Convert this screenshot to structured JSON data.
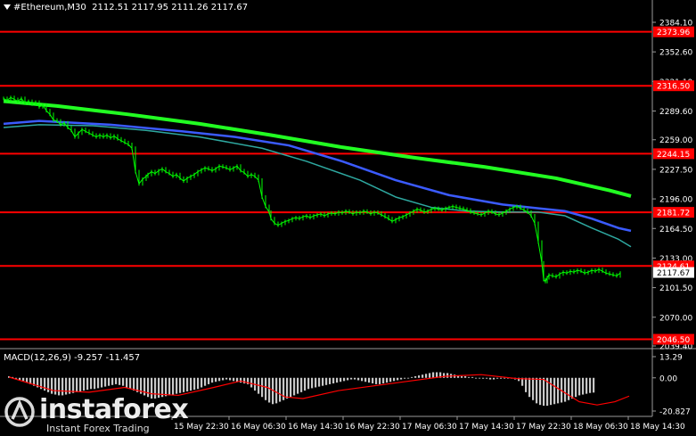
{
  "header": {
    "symbol": "#Ethereum,M30",
    "ohlc": "2112.51 2117.95 2111.26 2117.67"
  },
  "macd": {
    "label": "MACD(12,26,9) -9.257 -11.457",
    "axis": [
      "13.29",
      "0.00",
      "-20.827"
    ]
  },
  "price_axis": [
    "2384.10",
    "2352.60",
    "2321.10",
    "2289.60",
    "2259.00",
    "2227.50",
    "2196.00",
    "2164.50",
    "2133.00",
    "2101.50",
    "2070.00",
    "2039.40"
  ],
  "levels": [
    {
      "label": "2373.96",
      "value": 2373.96
    },
    {
      "label": "2316.50",
      "value": 2316.5
    },
    {
      "label": "2244.15",
      "value": 2244.15
    },
    {
      "label": "2181.72",
      "value": 2181.72
    },
    {
      "label": "2124.61",
      "value": 2124.61
    },
    {
      "label": "2046.50",
      "value": 2046.5
    }
  ],
  "current_price": {
    "label": "2117.67",
    "value": 2117.67
  },
  "time_axis": [
    "15 May 22:30",
    "16 May 06:30",
    "16 May 14:30",
    "16 May 22:30",
    "17 May 06:30",
    "17 May 14:30",
    "17 May 22:30",
    "18 May 06:30",
    "18 May 14:30"
  ],
  "watermark": {
    "brand": "instaforex",
    "tagline": "Instant Forex Trading"
  },
  "colors": {
    "background": "#000000",
    "level": "#ff0000",
    "price": "#00ff00",
    "ma_fast": "#2ea8a0",
    "ma_mid": "#3b5bff",
    "ma_slow": "#22ff22",
    "histogram": "#c8c8c8",
    "signal": "#ff0000"
  },
  "chart_data": {
    "type": "candlestick",
    "price": {
      "x": [
        0,
        4,
        8,
        12,
        16,
        20,
        24,
        28,
        32,
        36,
        40,
        44,
        48,
        52,
        56,
        60,
        64,
        68,
        72,
        76,
        80,
        84,
        88,
        92,
        96,
        100,
        104,
        108,
        112,
        116,
        120,
        124,
        128,
        132,
        136,
        140,
        144,
        148,
        152,
        156,
        160,
        162,
        166,
        170,
        174,
        178,
        182,
        186,
        190,
        194,
        198,
        202,
        206,
        210,
        214,
        218,
        222,
        226,
        230,
        234,
        238,
        242,
        246,
        250,
        254,
        258,
        262,
        266,
        270,
        274,
        278,
        282,
        286,
        290,
        294,
        298,
        300,
        304,
        308,
        312,
        316,
        320,
        324,
        328,
        332,
        336,
        340,
        344,
        348,
        352,
        356,
        360,
        364,
        368,
        372,
        376,
        380,
        384,
        388,
        392,
        396,
        400,
        404,
        408,
        412,
        416,
        420,
        424,
        428,
        432,
        436,
        440,
        444,
        448,
        452,
        456,
        460,
        464,
        468,
        472,
        476,
        480,
        484,
        488,
        492,
        496,
        500,
        504,
        508,
        512,
        516,
        520,
        524,
        528,
        532,
        536,
        540,
        544,
        548,
        552,
        556,
        560,
        564,
        568,
        572,
        576,
        580,
        584,
        588,
        592,
        596,
        600,
        604,
        606,
        608,
        610,
        612,
        616,
        620,
        624,
        628,
        632,
        636,
        640,
        644,
        648,
        652,
        656,
        660,
        664,
        668,
        672,
        676,
        680,
        684,
        688,
        692,
        696,
        700,
        704
      ],
      "y": [
        2303,
        2301,
        2304,
        2302,
        2300,
        2303,
        2298,
        2300,
        2297,
        2299,
        2294,
        2296,
        2290,
        2286,
        2280,
        2279,
        2275,
        2277,
        2272,
        2269,
        2262,
        2266,
        2270,
        2268,
        2266,
        2264,
        2262,
        2264,
        2262,
        2264,
        2261,
        2263,
        2260,
        2258,
        2256,
        2254,
        2250,
        2225,
        2212,
        2217,
        2220,
        2222,
        2225,
        2223,
        2226,
        2228,
        2225,
        2223,
        2220,
        2222,
        2218,
        2215,
        2218,
        2220,
        2222,
        2225,
        2227,
        2229,
        2228,
        2226,
        2228,
        2231,
        2230,
        2229,
        2227,
        2229,
        2231,
        2226,
        2224,
        2220,
        2222,
        2220,
        2216,
        2198,
        2188,
        2182,
        2175,
        2170,
        2168,
        2170,
        2172,
        2173,
        2175,
        2176,
        2175,
        2177,
        2178,
        2176,
        2178,
        2179,
        2180,
        2178,
        2180,
        2181,
        2180,
        2182,
        2181,
        2183,
        2182,
        2180,
        2182,
        2181,
        2183,
        2182,
        2180,
        2182,
        2181,
        2179,
        2177,
        2175,
        2172,
        2174,
        2176,
        2177,
        2179,
        2181,
        2183,
        2185,
        2184,
        2182,
        2183,
        2185,
        2186,
        2185,
        2184,
        2186,
        2187,
        2188,
        2187,
        2186,
        2185,
        2184,
        2182,
        2181,
        2180,
        2179,
        2181,
        2183,
        2182,
        2180,
        2179,
        2181,
        2183,
        2185,
        2187,
        2188,
        2186,
        2184,
        2182,
        2178,
        2170,
        2150,
        2128,
        2110,
        2108,
        2112,
        2115,
        2114,
        2113,
        2116,
        2118,
        2117,
        2119,
        2118,
        2120,
        2119,
        2117,
        2118,
        2120,
        2119,
        2121,
        2119,
        2117,
        2116,
        2115,
        2114,
        2117
      ]
    },
    "ma_slow": {
      "x": [
        0,
        60,
        140,
        220,
        300,
        380,
        460,
        540,
        620,
        680,
        704
      ],
      "y": [
        2300,
        2295,
        2286,
        2276,
        2264,
        2251,
        2240,
        2230,
        2218,
        2205,
        2199
      ]
    },
    "ma_mid": {
      "x": [
        0,
        40,
        120,
        200,
        260,
        320,
        380,
        440,
        500,
        560,
        600,
        630,
        660,
        690,
        704
      ],
      "y": [
        2276,
        2279,
        2275,
        2268,
        2262,
        2253,
        2236,
        2216,
        2200,
        2190,
        2186,
        2183,
        2175,
        2165,
        2162
      ]
    },
    "ma_fast": {
      "x": [
        0,
        40,
        100,
        160,
        220,
        290,
        340,
        400,
        440,
        480,
        520,
        560,
        600,
        630,
        660,
        690,
        704
      ],
      "y": [
        2272,
        2275,
        2274,
        2269,
        2262,
        2250,
        2236,
        2216,
        2198,
        2187,
        2183,
        2182,
        2182,
        2178,
        2165,
        2153,
        2145
      ]
    },
    "macd_hist": {
      "x": [
        10,
        14,
        18,
        22,
        26,
        30,
        34,
        38,
        42,
        46,
        50,
        54,
        58,
        62,
        66,
        70,
        74,
        78,
        82,
        86,
        90,
        94,
        98,
        102,
        106,
        110,
        114,
        118,
        122,
        126,
        130,
        134,
        138,
        142,
        146,
        150,
        154,
        158,
        162,
        166,
        170,
        174,
        178,
        182,
        186,
        190,
        194,
        198,
        202,
        206,
        210,
        214,
        218,
        222,
        226,
        230,
        234,
        238,
        242,
        246,
        250,
        254,
        258,
        262,
        266,
        270,
        274,
        278,
        282,
        286,
        290,
        294,
        298,
        302,
        306,
        310,
        314,
        318,
        322,
        326,
        330,
        334,
        338,
        342,
        346,
        350,
        354,
        358,
        362,
        366,
        370,
        374,
        378,
        382,
        386,
        390,
        394,
        398,
        402,
        406,
        410,
        414,
        418,
        422,
        426,
        430,
        434,
        438,
        442,
        446,
        450,
        454,
        458,
        462,
        466,
        470,
        474,
        478,
        482,
        486,
        490,
        494,
        498,
        502,
        506,
        510,
        514,
        518,
        522,
        526,
        530,
        534,
        538,
        542,
        546,
        550,
        554,
        558,
        562,
        566,
        570,
        574,
        578,
        582,
        586,
        590,
        594,
        598,
        602,
        606,
        610,
        614,
        618,
        622,
        626,
        630,
        634,
        638,
        642,
        646,
        650,
        654,
        658,
        662,
        666,
        670,
        674,
        678,
        682,
        686,
        690,
        694,
        698,
        702,
        706
      ],
      "values": [
        1,
        0.5,
        -0.5,
        -1.5,
        -2,
        -3,
        -4,
        -5,
        -6,
        -7,
        -8,
        -9,
        -10,
        -10.5,
        -11,
        -11,
        -10.5,
        -10,
        -9.5,
        -9,
        -8.5,
        -8,
        -7.5,
        -7,
        -7,
        -6.5,
        -6,
        -5.5,
        -5,
        -4.5,
        -4,
        -4.5,
        -5,
        -6,
        -7,
        -8,
        -9,
        -10,
        -11,
        -12,
        -13,
        -13,
        -12.5,
        -12,
        -11.5,
        -11,
        -10.5,
        -10,
        -9.5,
        -9,
        -8.5,
        -8,
        -7.5,
        -7,
        -6,
        -5,
        -4,
        -3,
        -2.5,
        -2,
        -1.5,
        -1,
        -1.5,
        -2,
        -2.5,
        -3,
        -3.5,
        -4,
        -6,
        -8,
        -10,
        -12,
        -14,
        -15.5,
        -16.5,
        -16,
        -15,
        -14,
        -13,
        -12,
        -11,
        -10,
        -9,
        -8,
        -7,
        -6.5,
        -6,
        -5.5,
        -5,
        -4.5,
        -4,
        -3.5,
        -3,
        -2.5,
        -2,
        -1.5,
        -1,
        -1,
        -1.5,
        -2,
        -2.5,
        -3,
        -3.5,
        -4,
        -4,
        -3.5,
        -3,
        -2.5,
        -2,
        -1.5,
        -1,
        -0.5,
        0,
        0.5,
        1,
        1.5,
        2,
        2.5,
        3,
        3.5,
        3.5,
        3.5,
        3,
        3,
        2.5,
        2,
        1.5,
        1,
        1,
        0.5,
        0.5,
        0,
        0,
        -0.5,
        -0.5,
        -1,
        -1,
        -0.5,
        -0.5,
        0,
        0,
        -0.5,
        -1,
        -2,
        -5,
        -9,
        -12,
        -14,
        -16,
        -17,
        -17.5,
        -17.5,
        -17,
        -16.5,
        -16,
        -15.5,
        -15,
        -14,
        -13,
        -12,
        -11,
        -10.5,
        -10,
        -9.5,
        -9.257
      ]
    },
    "macd_signal": {
      "x": [
        10,
        60,
        100,
        140,
        170,
        200,
        240,
        270,
        300,
        320,
        340,
        380,
        420,
        460,
        500,
        540,
        580,
        610,
        630,
        650,
        670,
        690,
        706
      ],
      "values": [
        0.5,
        -8,
        -9,
        -6,
        -10,
        -11,
        -6,
        -2,
        -6,
        -12,
        -13,
        -8,
        -5,
        -2,
        1,
        2,
        -0.5,
        -1,
        -8,
        -15,
        -17,
        -15,
        -11.457
      ]
    }
  }
}
